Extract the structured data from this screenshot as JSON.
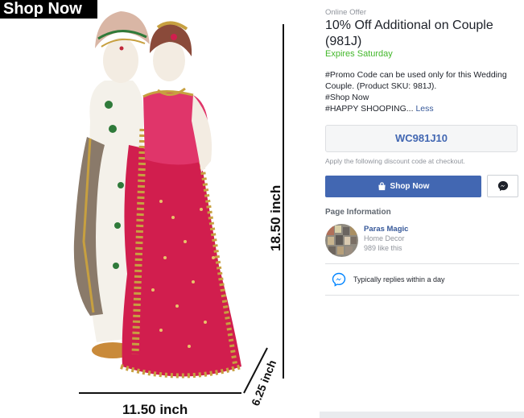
{
  "image": {
    "banner": "Shop Now",
    "dimensions": {
      "height": "18.50 inch",
      "width": "11.50 inch",
      "depth": "6.25 inch"
    }
  },
  "offer": {
    "label": "Online Offer",
    "title": "10% Off Additional on Couple (981J)",
    "expires": "Expires Saturday",
    "description": {
      "line1": "#Promo Code can be used only for this Wedding Couple. (Product SKU: 981J).",
      "line2": "#Shop Now",
      "line3": "#HAPPY SHOOPING...",
      "less_link": "Less"
    },
    "promo_code": "WC981J10",
    "code_hint": "Apply the following discount code at checkout.",
    "shop_button": "Shop Now",
    "messenger_icon": "messenger-icon",
    "colors": {
      "accent": "#4267b2",
      "expires": "#42b72a",
      "link": "#365899"
    }
  },
  "page_info": {
    "heading": "Page Information",
    "name": "Paras Magic",
    "category": "Home Decor",
    "likes": "989 like this",
    "reply": "Typically replies within a day"
  }
}
